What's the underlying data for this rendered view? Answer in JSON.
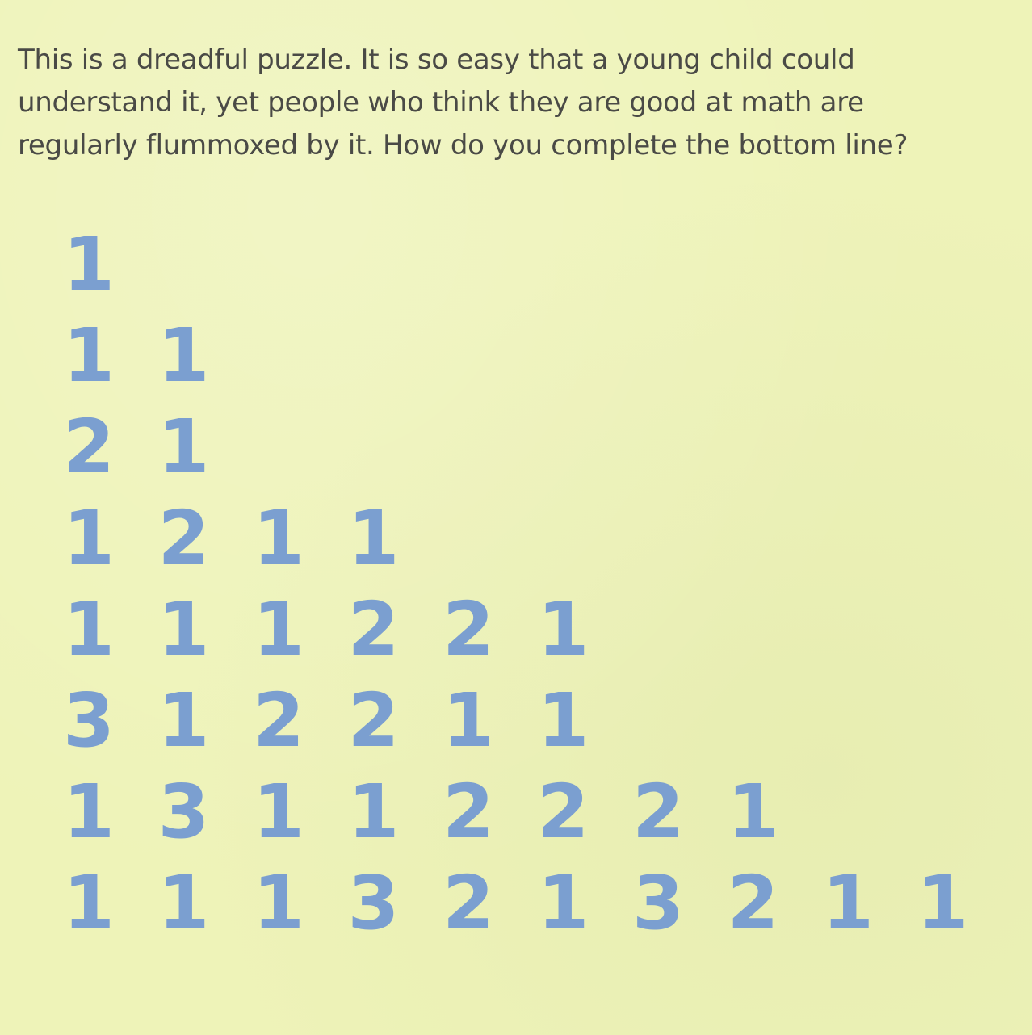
{
  "intro": {
    "lines": [
      "This is a dreadful puzzle. It is so easy that a young child could",
      "understand it, yet people who think they are good at math are",
      "regularly flummoxed by it. How do you complete the bottom line?"
    ]
  },
  "sequence": {
    "rows": [
      [
        "1"
      ],
      [
        "1",
        "1"
      ],
      [
        "2",
        "1"
      ],
      [
        "1",
        "2",
        "1",
        "1"
      ],
      [
        "1",
        "1",
        "1",
        "2",
        "2",
        "1"
      ],
      [
        "3",
        "1",
        "2",
        "2",
        "1",
        "1"
      ],
      [
        "1",
        "3",
        "1",
        "1",
        "2",
        "2",
        "2",
        "1"
      ],
      [
        "1",
        "1",
        "1",
        "3",
        "2",
        "1",
        "3",
        "2",
        "1",
        "1"
      ]
    ]
  },
  "colors": {
    "background": "#eef3b8",
    "text": "#4a4a46",
    "digits": "#7b9fd0"
  }
}
